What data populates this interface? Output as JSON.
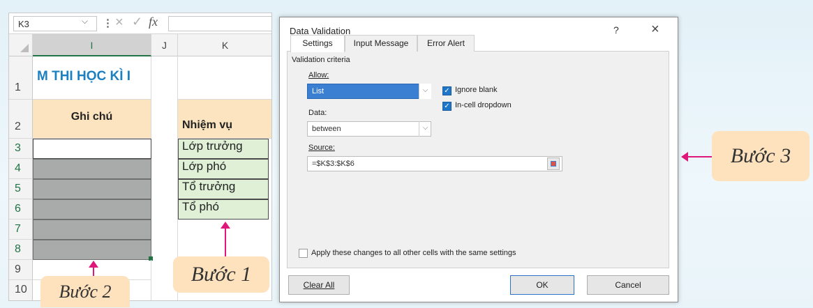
{
  "formula_bar": {
    "name_box": "K3",
    "fx": "fx",
    "cancel_glyph": "×",
    "confirm_glyph": "✓",
    "dots": "⋮",
    "dropdown_glyph": "⌵"
  },
  "columns": {
    "i": "I",
    "j": "J",
    "k": "K"
  },
  "rows": [
    "1",
    "2",
    "3",
    "4",
    "5",
    "6",
    "7",
    "8",
    "9",
    "10"
  ],
  "sheet": {
    "title": "M THI HỌC KÌ I",
    "ghi_chu": "Ghi chú",
    "nhiem_vu": "Nhiệm vụ",
    "roles": [
      "Lớp trưởng",
      "Lớp phó",
      "Tổ trưởng",
      "Tổ phó"
    ]
  },
  "annotations": {
    "buoc1": "Bước 1",
    "buoc2": "Bước 2",
    "buoc3": "Bước 3"
  },
  "colors": {
    "accent_pink": "#e0177a",
    "title_blue": "#1b7fc0",
    "bubble": "#fde2bd",
    "green_cell": "#dff0d6"
  },
  "dialog": {
    "title": "Data Validation",
    "help": "?",
    "close": "×",
    "tabs": [
      "Settings",
      "Input Message",
      "Error Alert"
    ],
    "section": "Validation criteria",
    "allow_label": "Allow:",
    "allow_value": "List",
    "ignore_blank": "Ignore blank",
    "in_cell_dropdown": "In-cell dropdown",
    "data_label": "Data:",
    "data_value": "between",
    "source_label": "Source:",
    "source_value": "=$K$3:$K$6",
    "apply_all": "Apply these changes to all other cells with the same settings",
    "clear_all": "Clear All",
    "ok": "OK",
    "cancel": "Cancel"
  }
}
